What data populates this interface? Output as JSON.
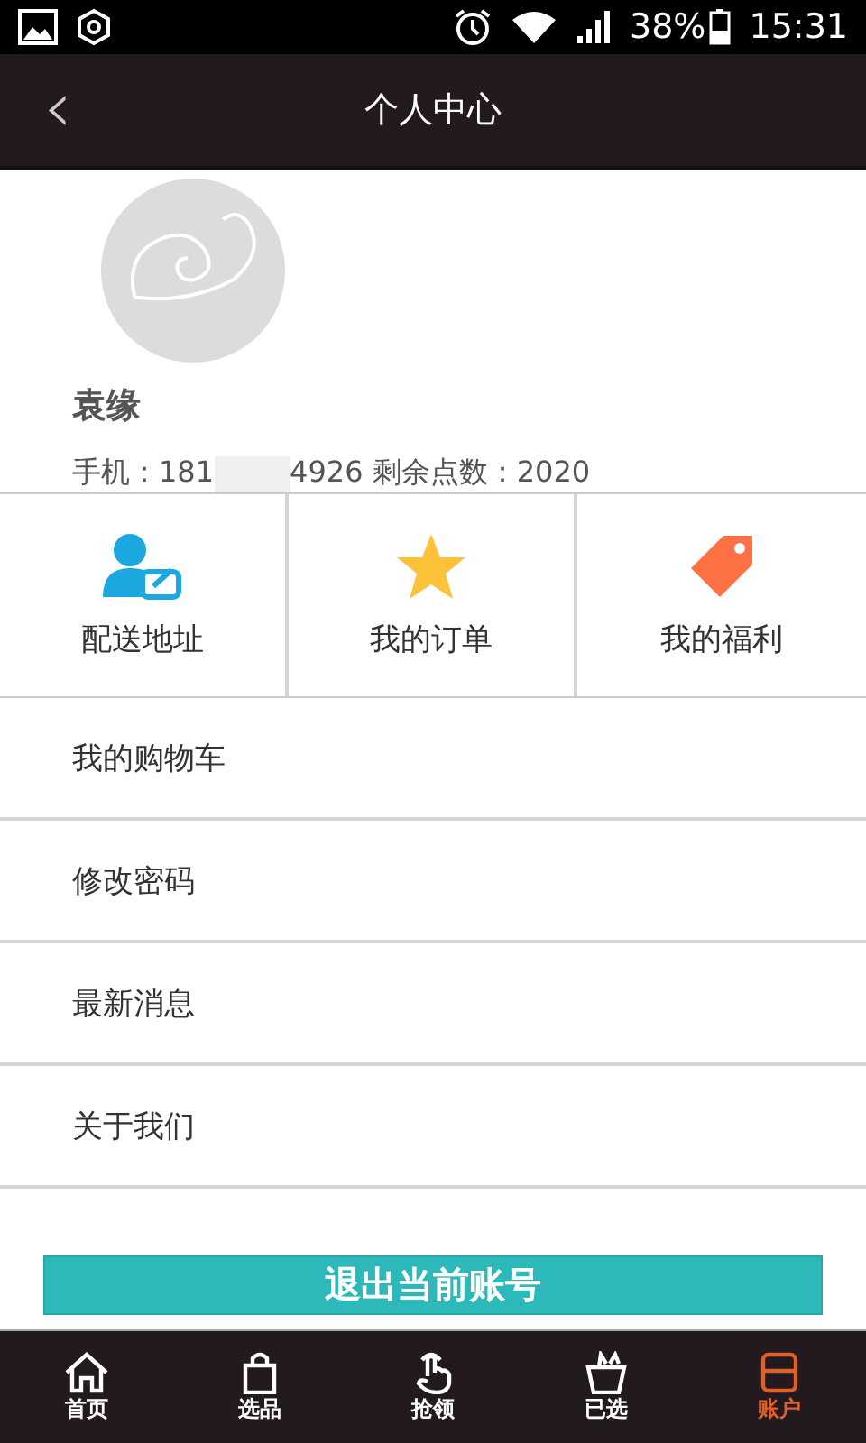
{
  "status_bar": {
    "battery": "38%",
    "time": "15:31"
  },
  "header": {
    "back": "‹",
    "title": "个人中心"
  },
  "profile": {
    "name": "袁缘",
    "phone_start": "手机：181",
    "phone_end": "4926 剩余点数：2020"
  },
  "shortcuts": [
    {
      "kind": "person",
      "label": "配送地址"
    },
    {
      "kind": "star",
      "label": "我的订单"
    },
    {
      "kind": "tag",
      "label": "我的福利"
    }
  ],
  "menu": [
    {
      "label": "我的购物车"
    },
    {
      "label": "修改密码"
    },
    {
      "label": "最新消息"
    },
    {
      "label": "关于我们"
    }
  ],
  "logout": "退出当前账号",
  "tabs": [
    {
      "kind": "home",
      "label": "首页",
      "selected": false
    },
    {
      "kind": "bag",
      "label": "选品",
      "selected": false
    },
    {
      "kind": "hand",
      "label": "抢领",
      "selected": false
    },
    {
      "kind": "basket",
      "label": "已选",
      "selected": false
    },
    {
      "kind": "account",
      "label": "账户",
      "selected": true
    }
  ]
}
